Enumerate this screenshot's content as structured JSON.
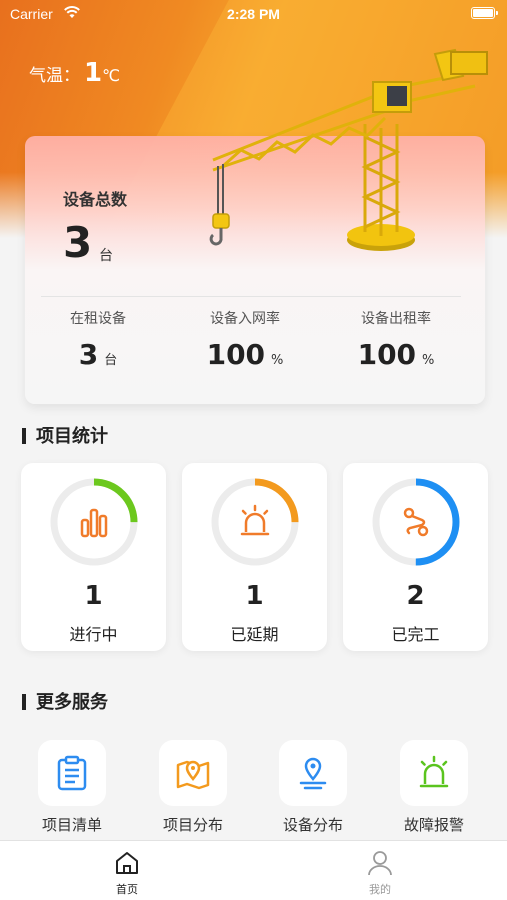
{
  "status_bar": {
    "carrier": "Carrier",
    "time": "2:28 PM"
  },
  "weather": {
    "label": "气温：",
    "value": "1",
    "unit": "℃"
  },
  "summary": {
    "title": "设备总数",
    "total": "3",
    "total_unit": "台",
    "stats": [
      {
        "label": "在租设备",
        "value": "3",
        "unit": "台"
      },
      {
        "label": "设备入网率",
        "value": "100",
        "unit": "%"
      },
      {
        "label": "设备出租率",
        "value": "100",
        "unit": "%"
      }
    ]
  },
  "project_stats": {
    "title": "项目统计",
    "cards": [
      {
        "label": "进行中",
        "count": "1",
        "icon": "bar-chart-icon",
        "color": "#6cc81e",
        "ring_fraction": 0.25
      },
      {
        "label": "已延期",
        "count": "1",
        "icon": "alarm-light-icon",
        "color": "#f39a1e",
        "ring_fraction": 0.25
      },
      {
        "label": "已完工",
        "count": "2",
        "icon": "route-icon",
        "color": "#1e8ff3",
        "ring_fraction": 0.5
      }
    ]
  },
  "services": {
    "title": "更多服务",
    "items": [
      {
        "label": "项目清单",
        "icon": "clipboard-list-icon",
        "color": "#2d8cf0"
      },
      {
        "label": "项目分布",
        "icon": "map-pin-icon",
        "color": "#f39a1e"
      },
      {
        "label": "设备分布",
        "icon": "location-icon",
        "color": "#2d8cf0"
      },
      {
        "label": "故障报警",
        "icon": "alarm-light-icon",
        "color": "#5ac41e"
      }
    ]
  },
  "tabbar": {
    "items": [
      {
        "label": "首页",
        "icon": "home-icon",
        "active": true
      },
      {
        "label": "我的",
        "icon": "user-icon",
        "active": false
      }
    ]
  }
}
